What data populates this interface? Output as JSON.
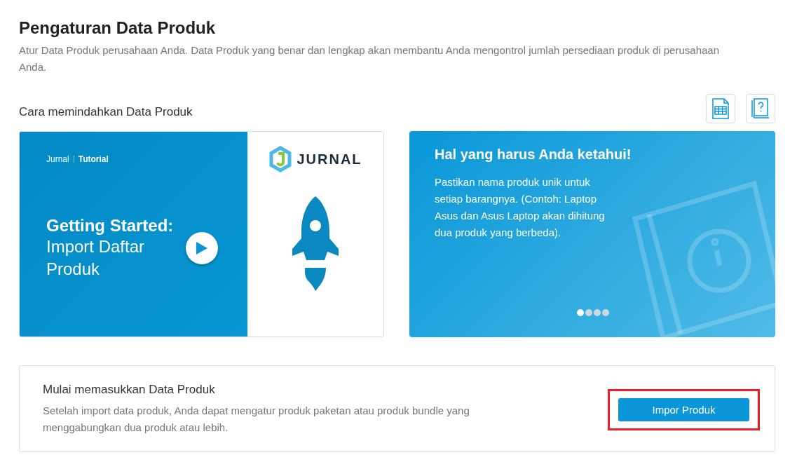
{
  "page": {
    "title": "Pengaturan Data Produk",
    "description": "Atur Data Produk perusahaan Anda. Data Produk yang benar dan lengkap akan membantu Anda mengontrol jumlah persediaan produk di perusahaan Anda."
  },
  "tutorial_section": {
    "heading": "Cara memindahkan Data Produk"
  },
  "video": {
    "brand": "Jurnal",
    "label": "Tutorial",
    "title_bold": "Getting Started:",
    "title_rest": "Import Daftar Produk",
    "logo_text": "JURNAL"
  },
  "tips": {
    "title": "Hal yang harus Anda ketahui!",
    "body": "Pastikan nama produk unik untuk setiap barangnya. (Contoh: Laptop Asus dan Asus Laptop akan dihitung dua produk yang berbeda).",
    "slides": [
      {
        "selected": true
      },
      {
        "selected": false
      },
      {
        "selected": false
      },
      {
        "selected": false
      }
    ]
  },
  "import_card": {
    "title": "Mulai memasukkan Data Produk",
    "description": "Setelah import data produk, Anda dapat mengatur produk paketan atau produk bundle yang menggabungkan dua produk atau lebih.",
    "button": "Impor Produk",
    "highlighted": true
  }
}
